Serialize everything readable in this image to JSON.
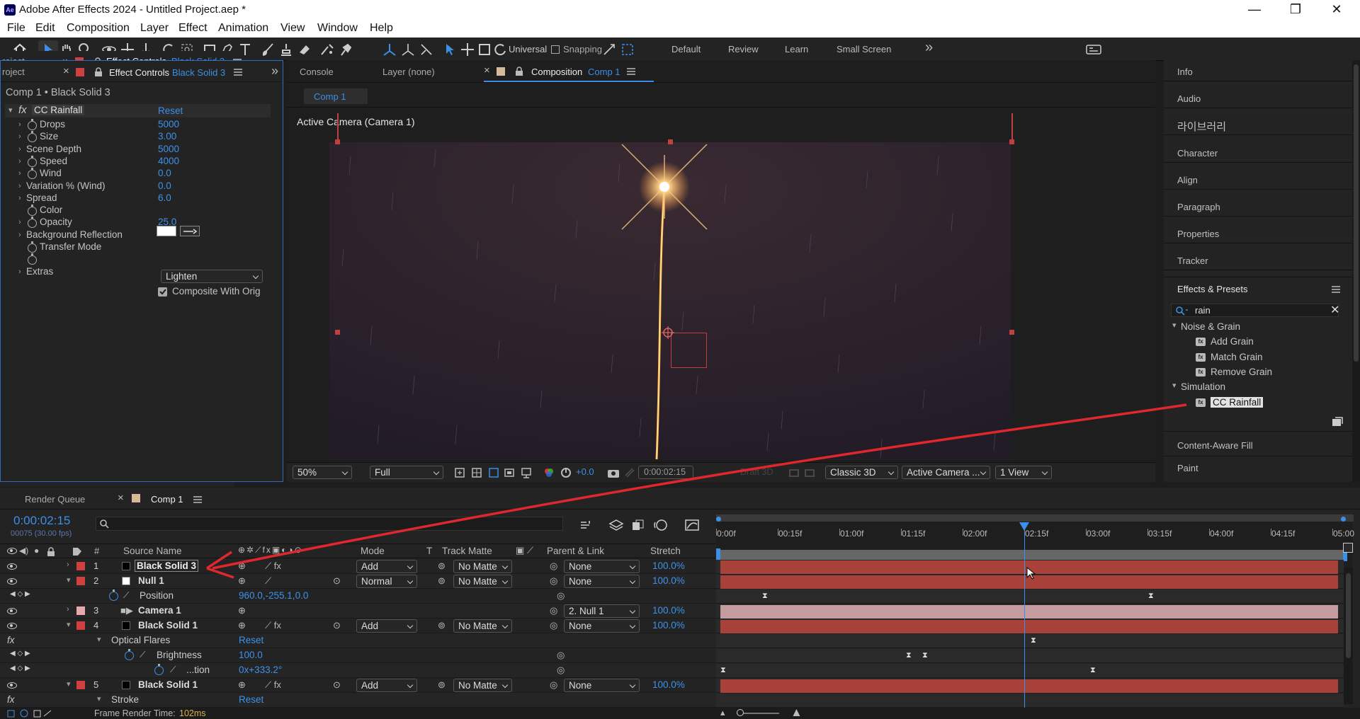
{
  "window": {
    "title": "Adobe After Effects 2024 - Untitled Project.aep *",
    "app_badge": "Ae",
    "min": "—",
    "max": "❐",
    "close": "✕"
  },
  "menu": [
    "File",
    "Edit",
    "Composition",
    "Layer",
    "Effect",
    "Animation",
    "View",
    "Window",
    "Help"
  ],
  "toolbar": {
    "axis_mode": "Universal",
    "snapping": "Snapping",
    "workspaces": [
      "Default",
      "Review",
      "Learn",
      "Small Screen"
    ],
    "more": "»"
  },
  "effect_controls": {
    "tab_project": "roject",
    "tab_label": "Effect Controls",
    "tab_layer": "Black Solid 3",
    "header": "Comp 1 • Black Solid 3",
    "effect_name": "CC Rainfall",
    "fx": "fx",
    "reset": "Reset",
    "props": [
      {
        "label": "Drops",
        "value": "5000"
      },
      {
        "label": "Size",
        "value": "3.00"
      },
      {
        "label": "Scene Depth",
        "value": "5000"
      },
      {
        "label": "Speed",
        "value": "4000"
      },
      {
        "label": "Wind",
        "value": "0.0"
      },
      {
        "label": "Variation % (Wind)",
        "value": "0.0"
      },
      {
        "label": "Spread",
        "value": "6.0"
      },
      {
        "label": "Color",
        "value": ""
      },
      {
        "label": "Opacity",
        "value": "25.0"
      },
      {
        "label": "Background Reflection",
        "value": ""
      },
      {
        "label": "Transfer Mode",
        "value": "Lighten"
      },
      {
        "label": "",
        "value": "Composite With Orig"
      },
      {
        "label": "Extras",
        "value": ""
      }
    ]
  },
  "viewer": {
    "tab_console": "Console",
    "tab_layer": "Layer (none)",
    "tab_comp_label": "Composition",
    "tab_comp_name": "Comp 1",
    "crumb": "Comp 1",
    "camera_label": "Active Camera (Camera 1)",
    "zoom": "50%",
    "resolution": "Full",
    "exposure": "+0.0",
    "timecode": "0:00:02:15",
    "draft3d": "Draft 3D",
    "renderer": "Classic 3D",
    "camera_view": "Active Camera ...",
    "views": "1 View"
  },
  "right_panel": {
    "items": [
      "Info",
      "Audio",
      "라이브러리",
      "Character",
      "Align",
      "Paragraph",
      "Properties",
      "Tracker"
    ],
    "effects_presets": "Effects & Presets",
    "search": "rain",
    "tree": [
      {
        "label": "Noise & Grain",
        "group": true
      },
      {
        "label": "Add Grain",
        "group": false
      },
      {
        "label": "Match Grain",
        "group": false
      },
      {
        "label": "Remove Grain",
        "group": false
      },
      {
        "label": "Simulation",
        "group": true
      },
      {
        "label": "CC Rainfall",
        "group": false,
        "selected": true
      }
    ],
    "bottom_items": [
      "Content-Aware Fill",
      "Paint"
    ]
  },
  "timeline": {
    "tab_render": "Render Queue",
    "tab_comp": "Comp 1",
    "timecode": "0:00:02:15",
    "frames": "00075 (30.00 fps)",
    "headers": {
      "num": "#",
      "source": "Source Name",
      "mode": "Mode",
      "t": "T",
      "track_matte": "Track Matte",
      "parent": "Parent & Link",
      "stretch": "Stretch"
    },
    "ruler": [
      "0:00f",
      "00:15f",
      "01:00f",
      "01:15f",
      "02:00f",
      "02:15f",
      "03:00f",
      "03:15f",
      "04:00f",
      "04:15f",
      "05:00"
    ],
    "playhead_fraction": 0.5,
    "layers": [
      {
        "num": "1",
        "name": "Black Solid 3",
        "color": "#d04040",
        "thumb": "#000000",
        "mode": "Add",
        "matte": "No Matte",
        "parent": "None",
        "stretch": "100.0%",
        "fx": true,
        "selected": true
      },
      {
        "num": "2",
        "name": "Null 1",
        "color": "#d04040",
        "thumb": "#ffffff",
        "mode": "Normal",
        "matte": "No Matte",
        "parent": "None",
        "stretch": "100.0%",
        "fx": false
      },
      {
        "num": "3",
        "name": "Camera 1",
        "color": "#e8a8b0",
        "thumb": "",
        "mode": "",
        "matte": "",
        "parent": "2. Null 1",
        "stretch": "100.0%",
        "fx": false
      },
      {
        "num": "4",
        "name": "Black Solid 1",
        "color": "#d04040",
        "thumb": "#000000",
        "mode": "Add",
        "matte": "No Matte",
        "parent": "None",
        "stretch": "100.0%",
        "fx": true
      },
      {
        "num": "5",
        "name": "Black Solid 1",
        "color": "#d04040",
        "thumb": "#000000",
        "mode": "Add",
        "matte": "No Matte",
        "parent": "None",
        "stretch": "100.0%",
        "fx": true
      }
    ],
    "position": {
      "label": "Position",
      "value": "960.0,-255.1,0.0"
    },
    "optical_flares": {
      "label": "Optical Flares",
      "reset": "Reset"
    },
    "brightness": {
      "label": "Brightness",
      "value": "100.0"
    },
    "rotation": {
      "label": "...tion",
      "value": "0x+333.2°"
    },
    "stroke": {
      "label": "Stroke",
      "reset": "Reset"
    },
    "render_time_label": "Frame Render Time:",
    "render_time": "102ms"
  },
  "colors": {
    "accent": "#3b8fe8",
    "annotation": "#e0272e",
    "track": "#a7413a",
    "camera_track": "#c49ca0"
  }
}
